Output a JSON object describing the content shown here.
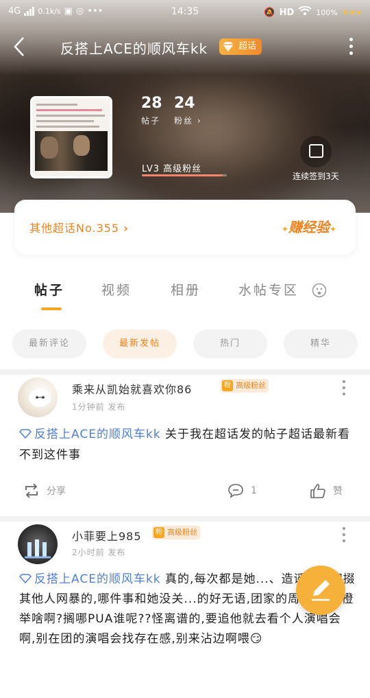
{
  "status_bar": {
    "network": "4G",
    "speed": "0.1k/s",
    "time": "14:35",
    "hd": "HD",
    "battery": "100%",
    "stars": "★★★"
  },
  "header": {
    "title": "反搭上ACE的顺风车kk",
    "badge": "超话",
    "post_count": "28",
    "post_label": "帖子",
    "fan_count": "24",
    "fan_label": "粉丝",
    "level_label": "LV3 高级粉丝",
    "level_progress": 0.95,
    "checkin_label": "连续签到3天"
  },
  "rank_card": {
    "rank_text": "其他超话No.355",
    "earn_label": "赚经验"
  },
  "tabs": [
    {
      "label": "帖子",
      "active": true
    },
    {
      "label": "视频",
      "active": false
    },
    {
      "label": "相册",
      "active": false
    },
    {
      "label": "水帖专区",
      "active": false
    }
  ],
  "filters": [
    {
      "label": "最新评论",
      "active": false
    },
    {
      "label": "最新发帖",
      "active": true
    },
    {
      "label": "热门",
      "active": false
    },
    {
      "label": "精华",
      "active": false
    }
  ],
  "posts": [
    {
      "username": "乘来从凯始就喜欢你86",
      "fan_badge": "高级粉丝",
      "time": "1分钟前 发布",
      "topic": "反搭上ACE的顺风车kk",
      "body": " 关于我在超话发的帖子超话最新看不到这件事",
      "share_label": "分享",
      "comment_count": "1",
      "like_label": "赞"
    },
    {
      "username": "小菲要上985",
      "fan_badge": "高级粉丝",
      "time": "2小时前 发布",
      "topic": "反搭上ACE的顺风车kk",
      "body": " 真的,每次都是她...、造谣的、撺掇其他人网暴的,哪件事和她没关...的好无语,团家的周年,不举橙举啥啊?搁哪PUA谁呢??怪离谱的,要追他就去看个人演唱会啊,别在团的演唱会找存在感,别来沾边啊喂😏"
    }
  ],
  "colors": {
    "accent": "#f0831e",
    "topic_blue": "#4f7fd9",
    "fab": "#f6b13a"
  }
}
